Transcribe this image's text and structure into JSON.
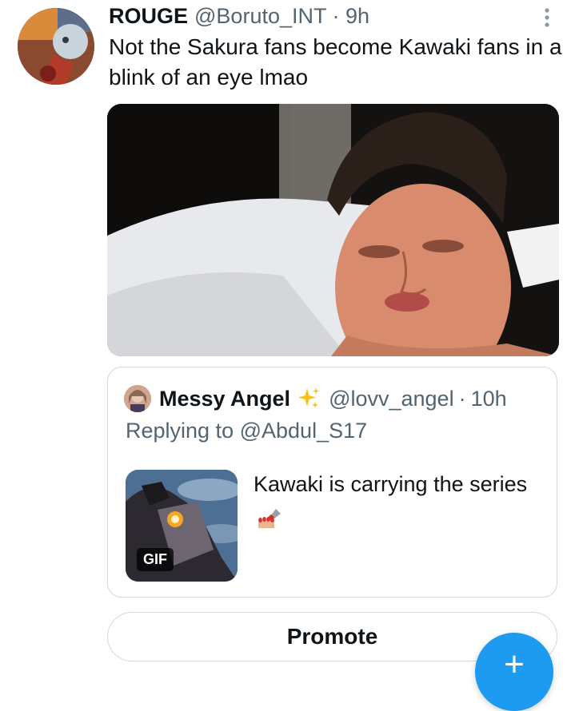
{
  "tweet": {
    "author_name": "ROUGE",
    "author_handle": "@Boruto_INT",
    "separator": "·",
    "time": "9h",
    "text": "Not the Sakura fans become Kawaki fans in a blink of an eye lmao"
  },
  "quoted_tweet": {
    "author_name": "Messy Angel",
    "author_handle": "@lovv_angel",
    "time": "10h",
    "replying_label": "Replying to",
    "replying_to": "@Abdul_S17",
    "text": "Kawaki is carrying the series",
    "gif_badge": "GIF"
  },
  "actions": {
    "promote_label": "Promote",
    "compose_symbol": "+"
  },
  "colors": {
    "accent": "#1d9bf0",
    "text_primary": "#0f1419",
    "text_secondary": "#536471",
    "border": "#cfd9de"
  },
  "icons": {
    "more": "more-vertical-icon",
    "sparkle": "sparkles-icon",
    "emoji": "nail-polish-emoji"
  }
}
